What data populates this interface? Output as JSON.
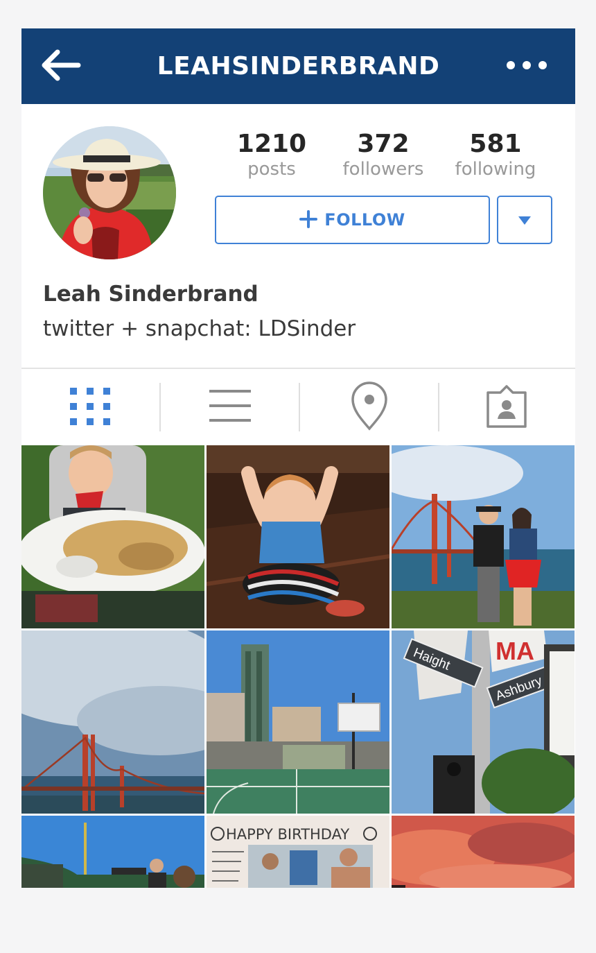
{
  "header": {
    "username": "LEAHSINDERBRAND"
  },
  "profile": {
    "stats": [
      {
        "value": "1210",
        "label": "posts"
      },
      {
        "value": "372",
        "label": "followers"
      },
      {
        "value": "581",
        "label": "following"
      }
    ],
    "follow_button": {
      "icon": "plus-icon",
      "label": "FOLLOW"
    },
    "full_name": "Leah Sinderbrand",
    "bio": "twitter + snapchat: LDSinder"
  },
  "tabs": [
    {
      "icon": "grid-icon",
      "active": true
    },
    {
      "icon": "list-icon",
      "active": false
    },
    {
      "icon": "location-pin-icon",
      "active": false
    },
    {
      "icon": "tagged-photos-icon",
      "active": false
    }
  ],
  "posts": {
    "birthday_card_text": "HAPPY BIRTHDAY",
    "street_sign_1": "Haight",
    "street_sign_2": "Ashbury",
    "street_banner": "MA"
  },
  "colors": {
    "header_bg": "#134176",
    "accent": "#3f81d6",
    "muted_text": "#999999"
  }
}
